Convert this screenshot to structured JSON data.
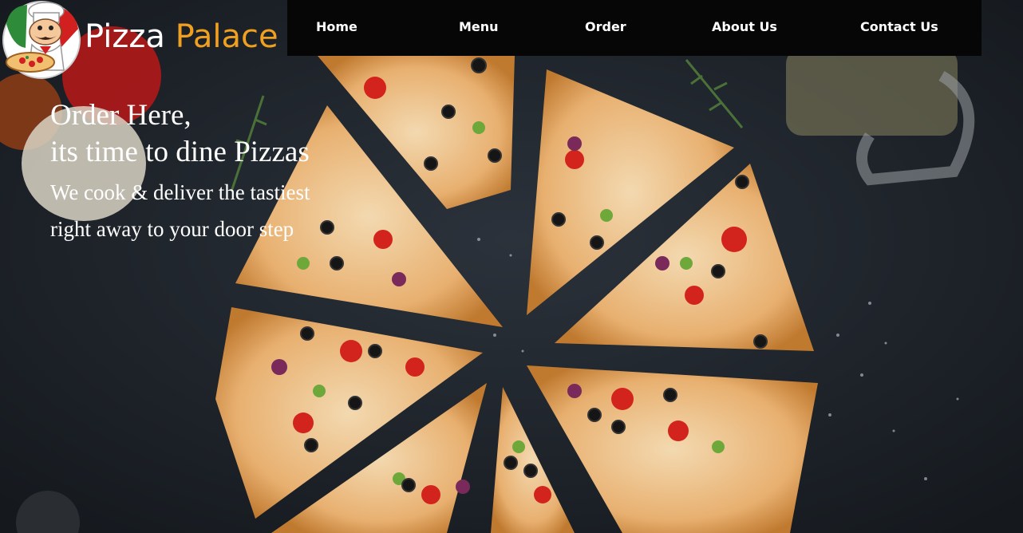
{
  "brand": {
    "name_part1": "Pizza",
    "name_part2": "Palace",
    "accent_color": "#f0a020"
  },
  "nav": {
    "items": [
      {
        "label": "Home"
      },
      {
        "label": "Menu"
      },
      {
        "label": "Order"
      },
      {
        "label": "About Us"
      },
      {
        "label": "Contact Us"
      }
    ]
  },
  "hero": {
    "heading_line1": "Order Here,",
    "heading_line2": "its time to dine Pizzas",
    "sub_line1": "We cook & deliver the tastiest",
    "sub_line2": "right away to your door step"
  },
  "icons": {
    "logo": "chef-mascot-logo",
    "background": "sliced-pizza-photo"
  }
}
